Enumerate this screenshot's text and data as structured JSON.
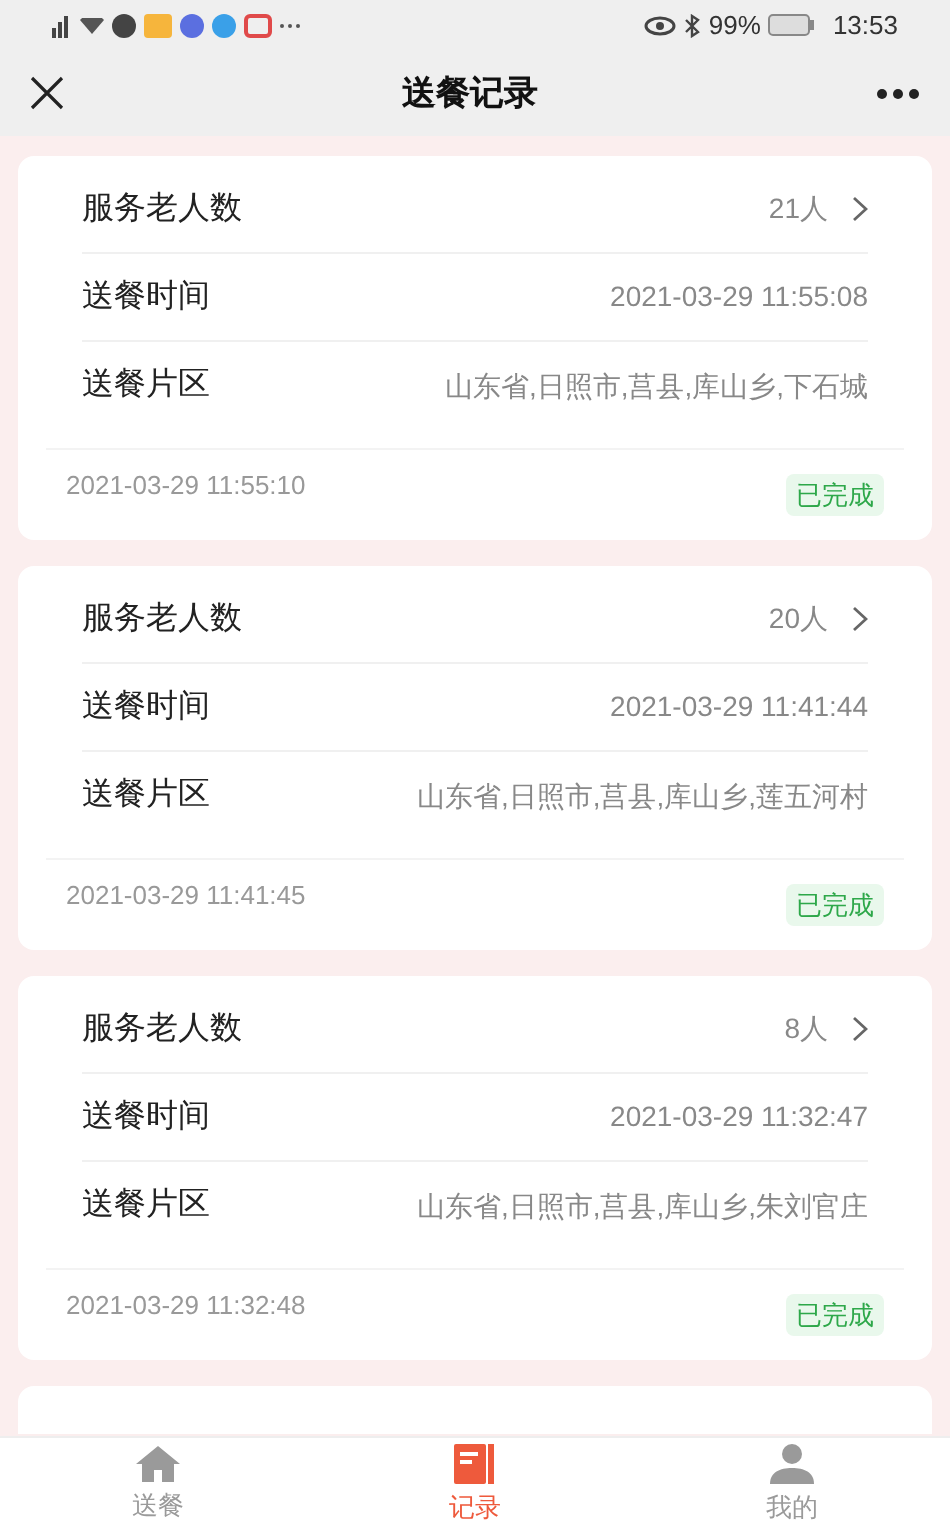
{
  "status_bar": {
    "battery": "99%",
    "time": "13:53"
  },
  "nav": {
    "title": "送餐记录"
  },
  "records": [
    {
      "rows": [
        {
          "kind": "link",
          "label": "服务老人数",
          "value": "21人"
        },
        {
          "kind": "plain",
          "label": "送餐时间",
          "value": "2021-03-29 11:55:08"
        },
        {
          "kind": "plain",
          "label": "送餐片区",
          "value": "山东省,日照市,莒县,库山乡,下石城"
        }
      ],
      "created": "2021-03-29 11:55:10",
      "status": "已完成"
    },
    {
      "rows": [
        {
          "kind": "link",
          "label": "服务老人数",
          "value": "20人"
        },
        {
          "kind": "plain",
          "label": "送餐时间",
          "value": "2021-03-29 11:41:44"
        },
        {
          "kind": "plain",
          "label": "送餐片区",
          "value": "山东省,日照市,莒县,库山乡,莲五河村"
        }
      ],
      "created": "2021-03-29 11:41:45",
      "status": "已完成"
    },
    {
      "rows": [
        {
          "kind": "link",
          "label": "服务老人数",
          "value": "8人"
        },
        {
          "kind": "plain",
          "label": "送餐时间",
          "value": "2021-03-29 11:32:47"
        },
        {
          "kind": "plain",
          "label": "送餐片区",
          "value": "山东省,日照市,莒县,库山乡,朱刘官庄"
        }
      ],
      "created": "2021-03-29 11:32:48",
      "status": "已完成"
    }
  ],
  "tabs": [
    {
      "kind": "home",
      "label": "送餐",
      "selected": false
    },
    {
      "kind": "record",
      "label": "记录",
      "selected": true
    },
    {
      "kind": "user",
      "label": "我的",
      "selected": false
    }
  ]
}
